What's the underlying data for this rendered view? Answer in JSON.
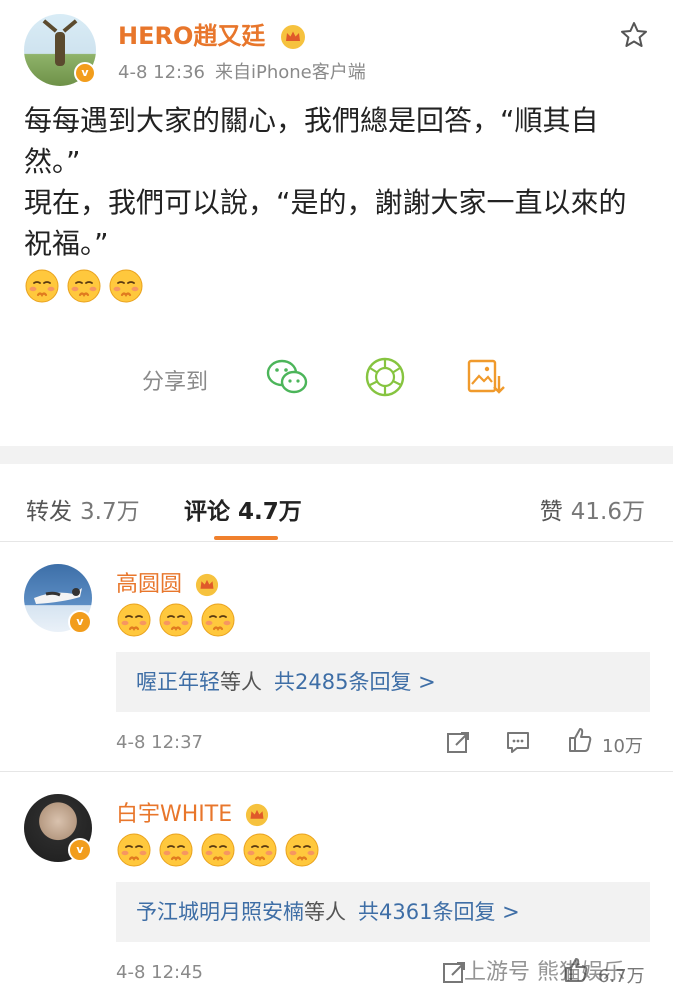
{
  "post": {
    "username": "HERO趙又廷",
    "date": "4-8 12:36",
    "source": "来自iPhone客户端",
    "text_lines": [
      "每每遇到大家的關心，我們總是回答，“順其自然。”",
      "現在，我們可以說，“是的，謝謝大家一直以來的祝福。”"
    ],
    "emoji_count": 3,
    "emoji_name": "shy-face-emoji",
    "share_label": "分享到",
    "share_targets": [
      "wechat-icon",
      "moments-icon",
      "save-image-icon"
    ]
  },
  "tabs": {
    "forward_label": "转发",
    "forward_count": "3.7万",
    "comment_label": "评论",
    "comment_count": "4.7万",
    "likes_label": "赞",
    "likes_count": "41.6万"
  },
  "comments": [
    {
      "name": "高圆圆",
      "emoji_count": 3,
      "reply_names": "喔正年轻",
      "reply_etc": "等人",
      "reply_count": "共2485条回复 >",
      "time": "4-8 12:37",
      "likes": "10万"
    },
    {
      "name": "白宇WHITE",
      "emoji_count": 5,
      "reply_names": "予江城明月照安楠",
      "reply_etc": "等人",
      "reply_count": "共4361条回复 >",
      "time": "4-8 12:45",
      "likes": "6.7万"
    }
  ],
  "watermark": "上游号 熊猫娱乐",
  "colors": {
    "username": "#e8762b",
    "accent_underline": "#f0802d",
    "reply_link": "#3e6ea6",
    "meta_gray": "#8a8a8a",
    "divider": "#f2f2f2"
  }
}
